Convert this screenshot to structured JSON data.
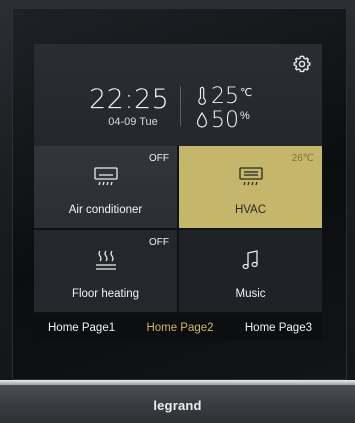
{
  "header": {
    "time": "22:25",
    "date": "04-09 Tue",
    "temperature": "25",
    "temperature_unit": "℃",
    "humidity": "50",
    "humidity_unit": "%",
    "settings_icon": "gear-icon",
    "thermometer_icon": "thermometer-icon",
    "humidity_icon": "water-drop-icon"
  },
  "tiles": [
    {
      "label": "Air conditioner",
      "status": "OFF",
      "icon": "air-conditioner-icon",
      "active": false
    },
    {
      "label": "HVAC",
      "status": "26℃",
      "icon": "hvac-icon",
      "active": true
    },
    {
      "label": "Floor heating",
      "status": "OFF",
      "icon": "floor-heating-icon",
      "active": false
    },
    {
      "label": "Music",
      "status": "",
      "icon": "music-note-icon",
      "active": false
    }
  ],
  "tabs": [
    {
      "label": "Home Page1",
      "active": false
    },
    {
      "label": "Home Page2",
      "active": true
    },
    {
      "label": "Home Page3",
      "active": false
    }
  ],
  "brand": "legrand",
  "colors": {
    "accent": "#c4b76b",
    "active_tab": "#c8b96c",
    "screen_bg": "#0f1114",
    "tile_bg": "#272a2e"
  }
}
